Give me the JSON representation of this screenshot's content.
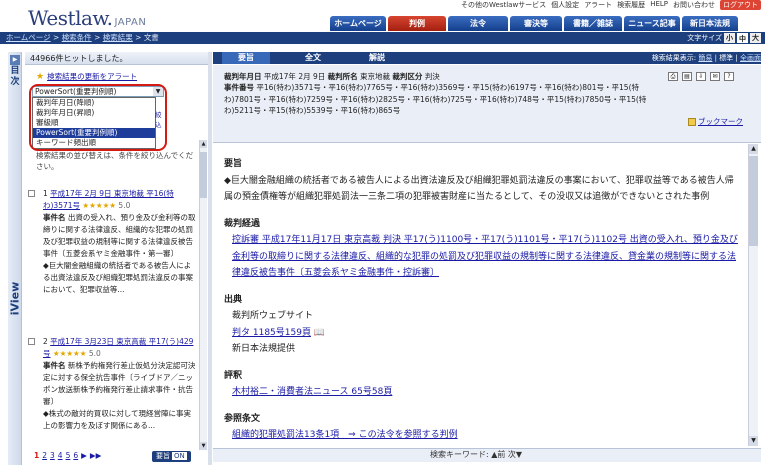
{
  "header": {
    "logo_main": "Westlaw.",
    "logo_sub": "JAPAN",
    "util_links": [
      "その他のWestlawサービス",
      "個人設定",
      "アラート",
      "検索履歴",
      "HELP",
      "お問い合わせ",
      "ログアウト"
    ],
    "nav_tabs": [
      "ホームページ",
      "判例",
      "法令",
      "審決等",
      "書籍／雑誌",
      "ニュース記事",
      "新日本法規"
    ],
    "breadcrumb": [
      "ホームページ",
      "検索条件",
      "検索結果",
      "文書"
    ],
    "font_size_label": "文字サイズ",
    "font_sizes": [
      "小",
      "中",
      "大"
    ]
  },
  "left": {
    "mokuji": "目次",
    "iview": "iView",
    "hits": "44966件ヒットしました。",
    "alert_link": "検索結果の更新をアラート",
    "sort_selected": "PowerSort(重要判例順)",
    "sort_options": [
      "裁判年月日(降順)",
      "裁判年月日(昇順)",
      "審級順",
      "PowerSort(重要判例順)",
      "キーワード頻出順"
    ],
    "small_btn": "絞込",
    "hint": "検索結果の並び替えは、条件を絞り込んでください。",
    "results": [
      {
        "num": "1",
        "title": "平成17年 2月 9日 東京地裁 平16(特わ)3571号",
        "stars": "★★★★★",
        "score": "5.0",
        "case_label": "事件名",
        "case_name": "出資の受入れ、預り金及び金利等の取締りに関する法律違反、組織的な犯罪の処罰及び犯罪収益の規制等に関する法律違反被告事件〔五菱会系ヤミ金融事件・第一審〕",
        "summary": "◆巨大闇金融組織の統括者である被告人による出資法違反及び組織犯罪処罰法違反の事案において、犯罪収益等..."
      },
      {
        "num": "2",
        "title": "平成17年 3月23日 東京高裁 平17(う)429号",
        "stars": "★★★★★",
        "score": "5.0",
        "case_label": "事件名",
        "case_name": "新株予約権発行差止仮処分決定認可決定に対する保全抗告事件〔ライブドア／ニッポン放送新株予約権発行差止請求事件・抗告審〕",
        "summary": "◆株式の敵対的買収に対して現経営陣に事実上の影響力を及ぼす関係にある..."
      }
    ],
    "pager": [
      "1",
      "2",
      "3",
      "4",
      "5",
      "6",
      "▶",
      "▶▶"
    ],
    "toggle_label": "要旨",
    "toggle_state": "ON"
  },
  "right": {
    "tabs": [
      "要旨",
      "全文",
      "解説"
    ],
    "display_mode_label": "検索結果表示:",
    "display_modes": [
      "簡易",
      "標準",
      "全画面"
    ],
    "meta": {
      "date_label": "裁判年月日",
      "date": "平成17年 2月 9日",
      "court_label": "裁判所名",
      "court": "東京地裁",
      "kind_label": "裁判区分",
      "kind": "判決",
      "case_no_label": "事件番号",
      "case_no": "平16(特わ)3571号・平16(特わ)7765号・平16(特わ)3569号・平15(特わ)6197号・平16(特わ)801号・平15(特わ)7801号・平16(特わ)7259号・平16(特わ)2825号・平16(特わ)725号・平16(特わ)748号・平15(特わ)7850号・平15(特わ)5211号・平15(特わ)5539号・平16(特わ)865号",
      "bookmark": "ブックマーク"
    },
    "sections": {
      "youshi_title": "要旨",
      "youshi": "◆巨大闇金融組織の統括者である被告人による出資法違反及び組織犯罪処罰法違反の事案において、犯罪収益等である被告人帰属の預金債権等が組織犯罪処罰法一三条二項の犯罪被害財産に当たるとして、その没収又は追徴ができないとされた事例",
      "keika_title": "裁判経過",
      "keika_link": "控訴審 平成17年11月17日 東京高裁 判決 平17(う)1100号・平17(う)1101号・平17(う)1102号 出資の受入れ、預り金及び金利等の取締りに関する法律違反、組織的な犯罪の処罰及び犯罪収益の規制等に関する法律違反、貸金業の規制等に関する法律違反被告事件〔五菱会系ヤミ金融事件・控訴審〕",
      "shutten_title": "出典",
      "shutten_items": [
        "裁判所ウェブサイト",
        "判タ 1185号159頁",
        "新日本法規提供"
      ],
      "hyoshaku_title": "評釈",
      "hyoshaku_link": "木村裕二・消費者法ニュース 65号58頁",
      "sansho_title": "参照条文",
      "sansho_link": "組織的犯罪処罰法13条1項　⇒ この法令を参照する判例"
    },
    "search_keyword": "検索キーワード: ▲前 次▼"
  },
  "colors": {
    "brand_blue": "#1d3f7d",
    "active_red": "#c42d1a",
    "highlight_red": "#d41a12",
    "link": "#1a1aa6",
    "star": "#e4a700"
  }
}
